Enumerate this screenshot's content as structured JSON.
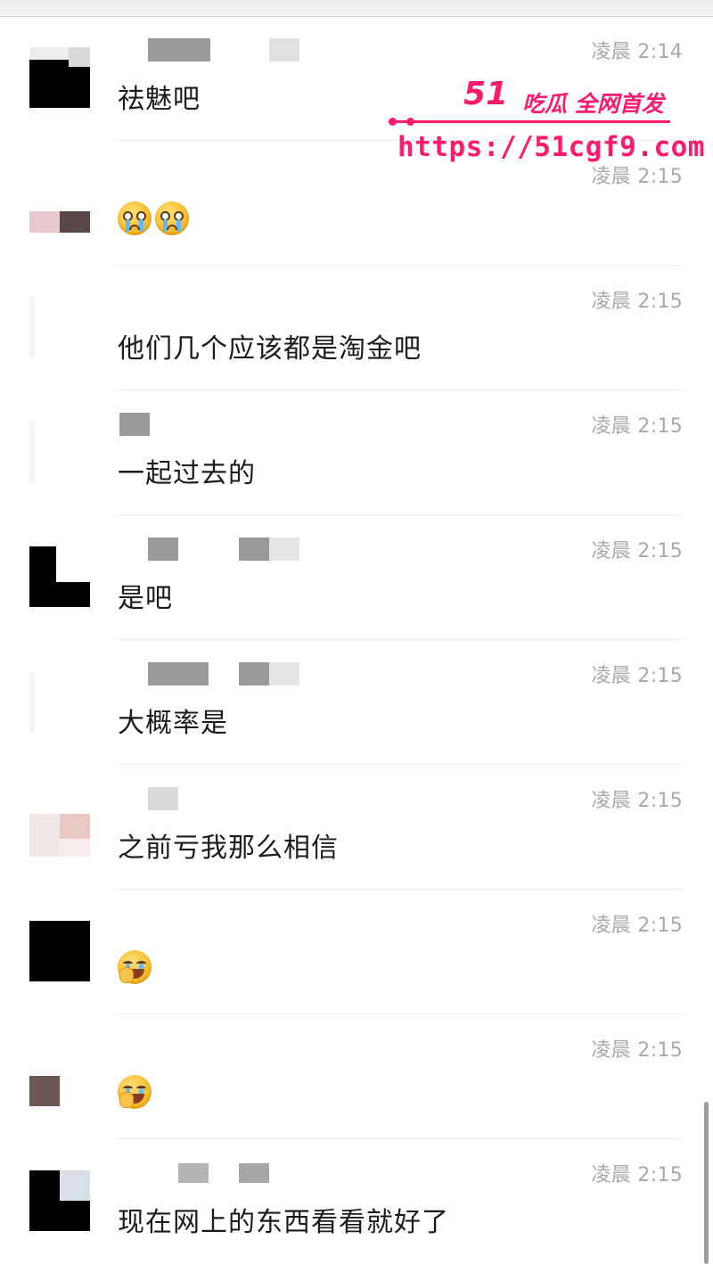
{
  "messages": [
    {
      "time": "凌晨 2:14",
      "text": "祛魅吧"
    },
    {
      "time": "凌晨 2:15",
      "text": "",
      "emoji": [
        "crying-face",
        "crying-face"
      ]
    },
    {
      "time": "凌晨 2:15",
      "text": "他们几个应该都是淘金吧"
    },
    {
      "time": "凌晨 2:15",
      "text": "一起过去的"
    },
    {
      "time": "凌晨 2:15",
      "text": "是吧"
    },
    {
      "time": "凌晨 2:15",
      "text": "大概率是"
    },
    {
      "time": "凌晨 2:15",
      "text": "之前亏我那么相信"
    },
    {
      "time": "凌晨 2:15",
      "text": "",
      "emoji": [
        "face-palm-laugh"
      ]
    },
    {
      "time": "凌晨 2:15",
      "text": "",
      "emoji": [
        "face-palm-laugh"
      ]
    },
    {
      "time": "凌晨 2:15",
      "text": "现在网上的东西看看就好了"
    }
  ],
  "watermark": {
    "logo": "51",
    "tagline": "吃瓜 全网首发",
    "url": "https://51cgf9.com"
  },
  "colors": {
    "watermark": "#ff1a6c",
    "time": "#a9a9a9",
    "text": "#1b1b1b",
    "separator": "#ececec"
  }
}
